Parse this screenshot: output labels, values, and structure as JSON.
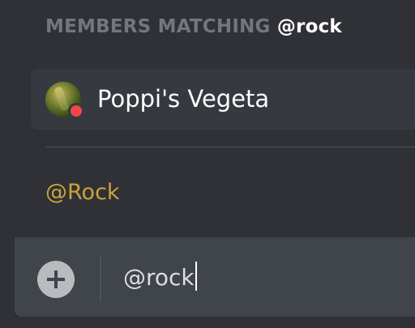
{
  "autocomplete": {
    "header_prefix": "MEMBERS MATCHING",
    "header_query": "@rock",
    "member": {
      "name": "Poppi's Vegeta",
      "status": "dnd",
      "status_color": "#f04747"
    },
    "role": {
      "label": "@Rock",
      "color": "#c9a33b"
    }
  },
  "composer": {
    "attach_icon": "plus-circle-icon",
    "value": "@rock"
  },
  "colors": {
    "background": "#2f3136",
    "row_highlight": "#36393f",
    "input_background": "#40444b"
  }
}
